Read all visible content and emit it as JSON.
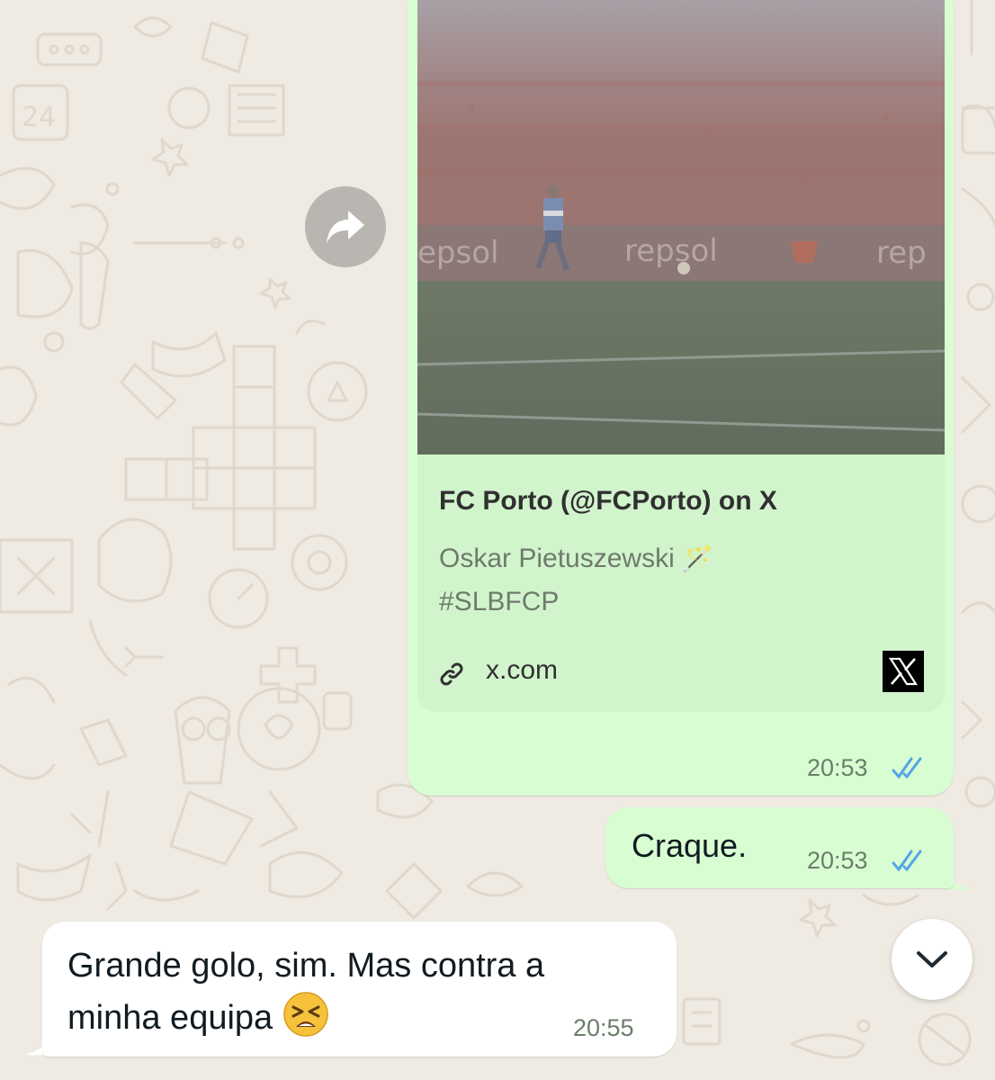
{
  "conversation": {
    "link_message": {
      "preview": {
        "image_alt": "FC Porto player in foggy stadium",
        "title": "FC Porto (@FCPorto) on X",
        "description_line1": "Oskar Pietuszewski",
        "description_emoji": "🪄",
        "description_line2": "#SLBFCP",
        "domain": "x.com",
        "site_icon": "x-logo-icon"
      },
      "time": "20:53",
      "status": "read"
    },
    "craque_message": {
      "text": "Craque.",
      "time": "20:53",
      "status": "read"
    },
    "incoming_message": {
      "line1": "Grande golo, sim. Mas contra a",
      "line2": "minha equipa",
      "emoji": "😫",
      "time": "20:55"
    }
  },
  "controls": {
    "forward_icon": "forward-icon",
    "scroll_down_icon": "chevron-down-icon"
  },
  "colors": {
    "chat_background": "#efeae2",
    "outgoing_bubble": "#d9fdd3",
    "preview_card": "#d1f4cc",
    "incoming_bubble": "#ffffff",
    "read_ticks": "#53a6e6"
  }
}
